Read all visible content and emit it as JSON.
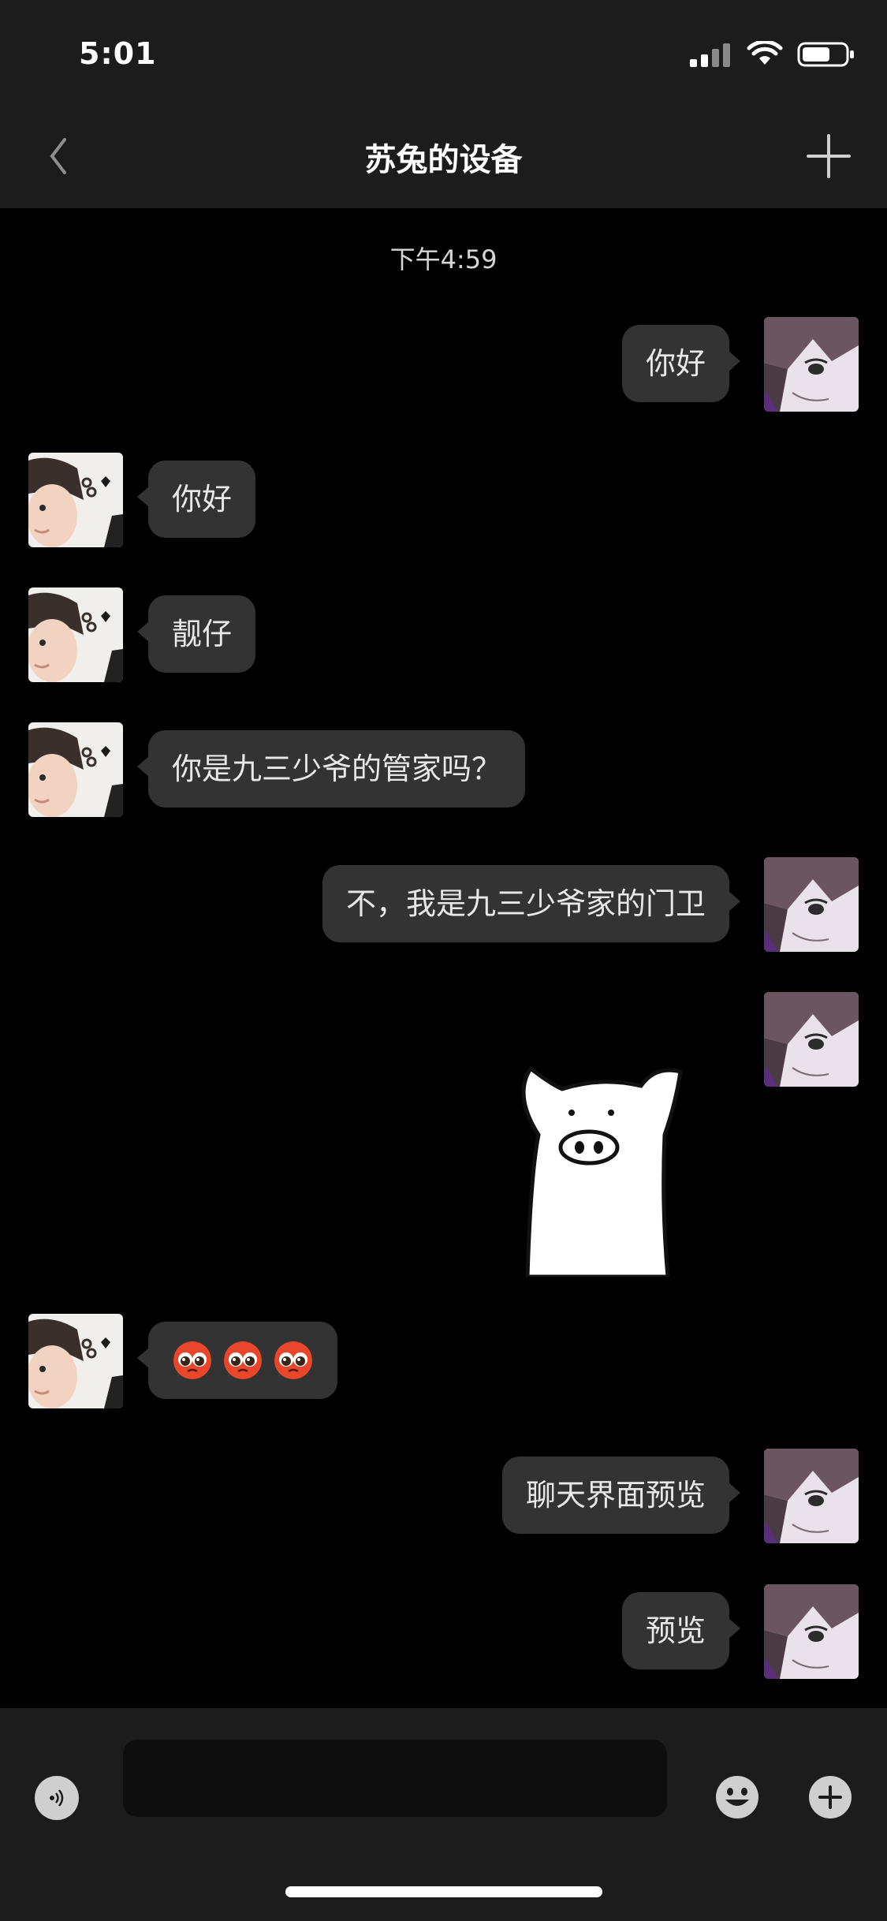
{
  "status_bar": {
    "time": "5:01"
  },
  "nav": {
    "title": "苏兔的设备"
  },
  "chat": {
    "timestamp": "下午4:59",
    "messages": [
      {
        "side": "right",
        "text": "你好"
      },
      {
        "side": "left",
        "text": "你好"
      },
      {
        "side": "left",
        "text": "靓仔"
      },
      {
        "side": "left",
        "text": "你是九三少爷的管家吗？"
      },
      {
        "side": "right",
        "text": "不，我是九三少爷家的门卫"
      },
      {
        "side": "right",
        "type": "sticker",
        "sticker": "pig-sticker"
      },
      {
        "side": "left",
        "type": "emoji",
        "emoji": [
          "pleading-face",
          "pleading-face",
          "pleading-face"
        ]
      },
      {
        "side": "right",
        "text": "聊天界面预览"
      },
      {
        "side": "right",
        "text": "预览"
      }
    ]
  },
  "input_bar": {
    "value": "",
    "placeholder": ""
  },
  "colors": {
    "background": "#000000",
    "bar": "#1c1c1c",
    "bubble": "#333333",
    "text": "#e8e8e8"
  }
}
